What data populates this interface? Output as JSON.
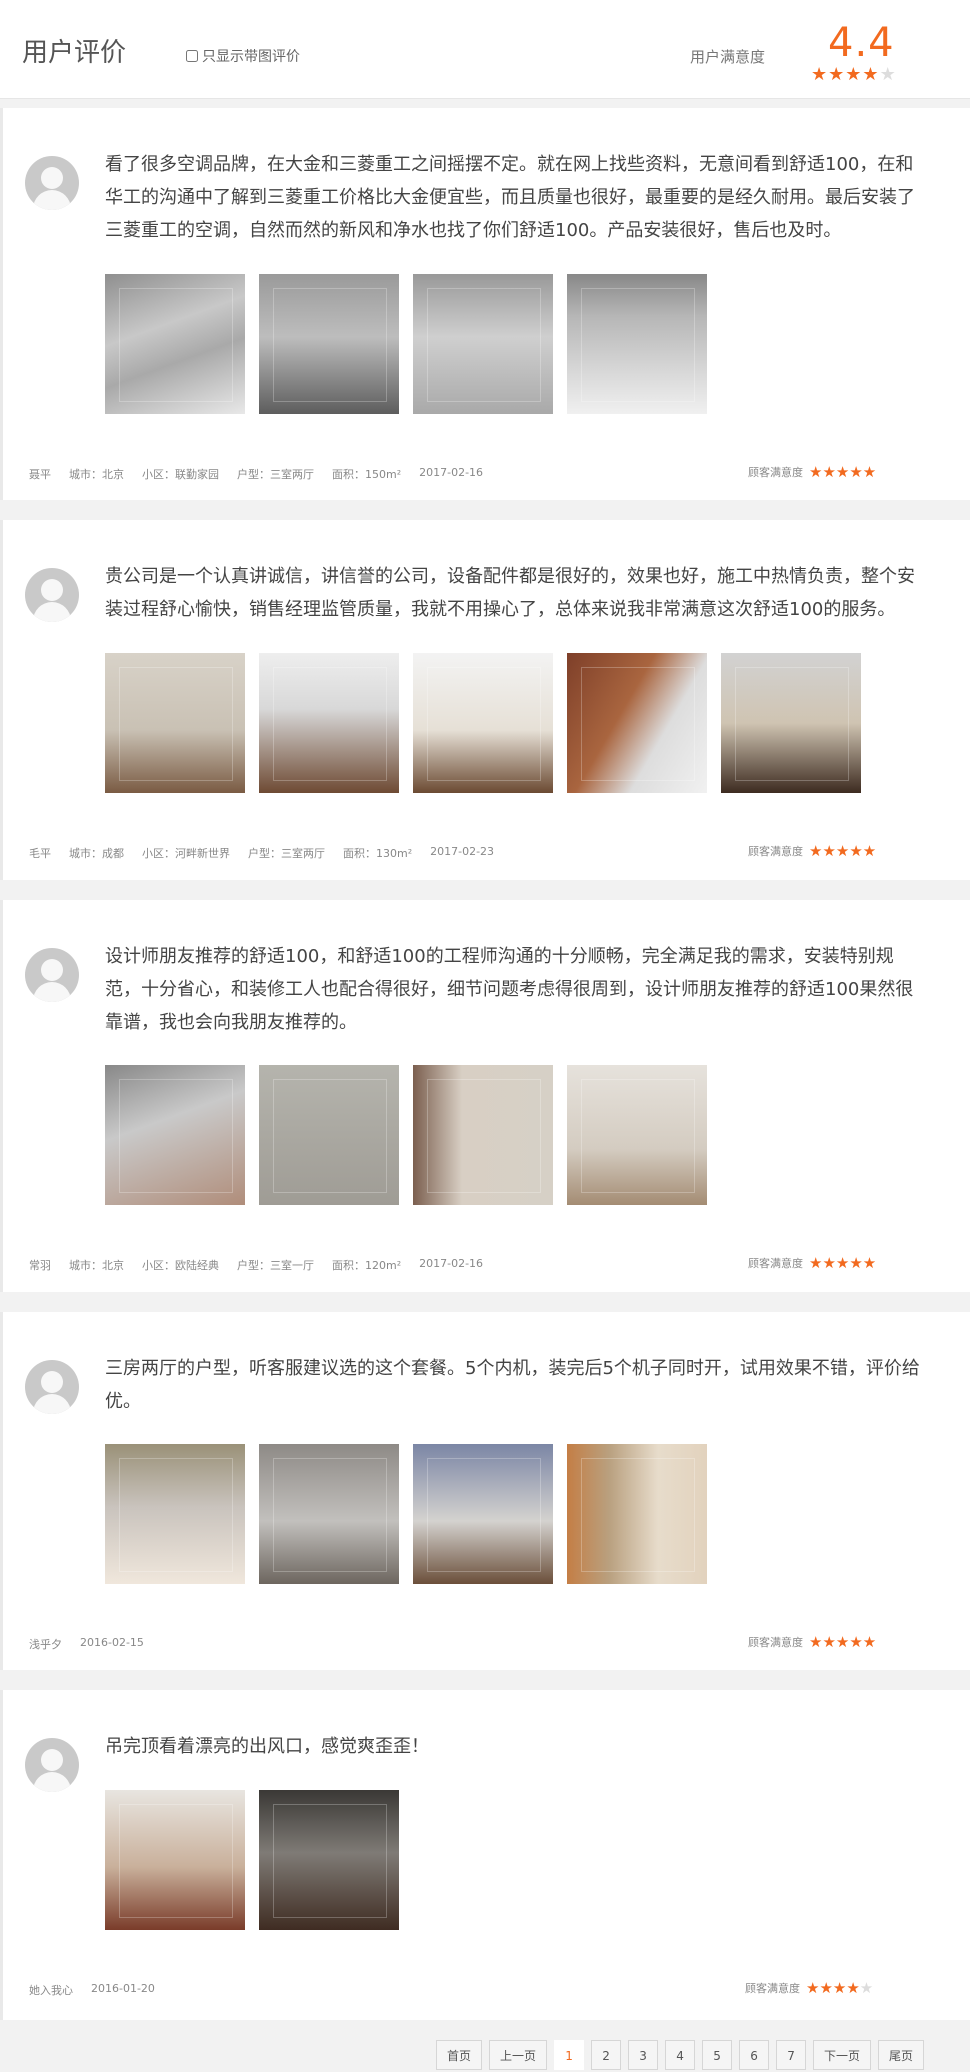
{
  "header": {
    "title": "用户评价",
    "only_photos_label": "只显示带图评价",
    "satisfaction_label": "用户满意度",
    "satisfaction_score": "4.4",
    "satisfaction_stars": 4,
    "accent_color": "#f26a1f"
  },
  "reviews": [
    {
      "text": "看了很多空调品牌，在大金和三菱重工之间摇摆不定。就在网上找些资料，无意间看到舒适100，在和华工的沟通中了解到三菱重工价格比大金便宜些，而且质量也很好，最重要的是经久耐用。最后安装了三菱重工的空调，自然而然的新风和净水也找了你们舒适100。产品安装很好，售后也及时。",
      "photos": [
        1,
        2,
        3,
        4
      ],
      "author": "聂平",
      "city": "城市：北京",
      "community": "小区：联勤家园",
      "layout": "户型：三室两厅",
      "area": "面积：150m²",
      "date": "2017-02-16",
      "rating_label": "顾客满意度",
      "stars": 5
    },
    {
      "text": "贵公司是一个认真讲诚信，讲信誉的公司，设备配件都是很好的，效果也好，施工中热情负责，整个安装过程舒心愉快，销售经理监管质量，我就不用操心了，总体来说我非常满意这次舒适100的服务。",
      "photos": [
        5,
        6,
        7,
        8,
        9
      ],
      "author": "毛平",
      "city": "城市：成都",
      "community": "小区：河畔新世界",
      "layout": "户型：三室两厅",
      "area": "面积：130m²",
      "date": "2017-02-23",
      "rating_label": "顾客满意度",
      "stars": 5
    },
    {
      "text": "设计师朋友推荐的舒适100，和舒适100的工程师沟通的十分顺畅，完全满足我的需求，安装特别规范，十分省心，和装修工人也配合得很好，细节问题考虑得很周到，设计师朋友推荐的舒适100果然很靠谱，我也会向我朋友推荐的。",
      "photos": [
        10,
        11,
        12,
        13
      ],
      "author": "常羽",
      "city": "城市：北京",
      "community": "小区：欧陆经典",
      "layout": "户型：三室一厅",
      "area": "面积：120m²",
      "date": "2017-02-16",
      "rating_label": "顾客满意度",
      "stars": 5
    },
    {
      "text": "三房两厅的户型，听客服建议选的这个套餐。5个内机，装完后5个机子同时开，试用效果不错，评价给优。",
      "photos": [
        14,
        15,
        16,
        17
      ],
      "author": "浅乎夕",
      "date": "2016-02-15",
      "rating_label": "顾客满意度",
      "stars": 5
    },
    {
      "text": "吊完顶看着漂亮的出风口，感觉爽歪歪！",
      "photos": [
        18,
        19
      ],
      "author": "她入我心",
      "date": "2016-01-20",
      "rating_label": "顾客满意度",
      "stars": 4
    }
  ],
  "pagination": {
    "first": "首页",
    "prev": "上一页",
    "pages": [
      "1",
      "2",
      "3",
      "4",
      "5",
      "6",
      "7"
    ],
    "current": "1",
    "next": "下一页",
    "last": "尾页"
  }
}
